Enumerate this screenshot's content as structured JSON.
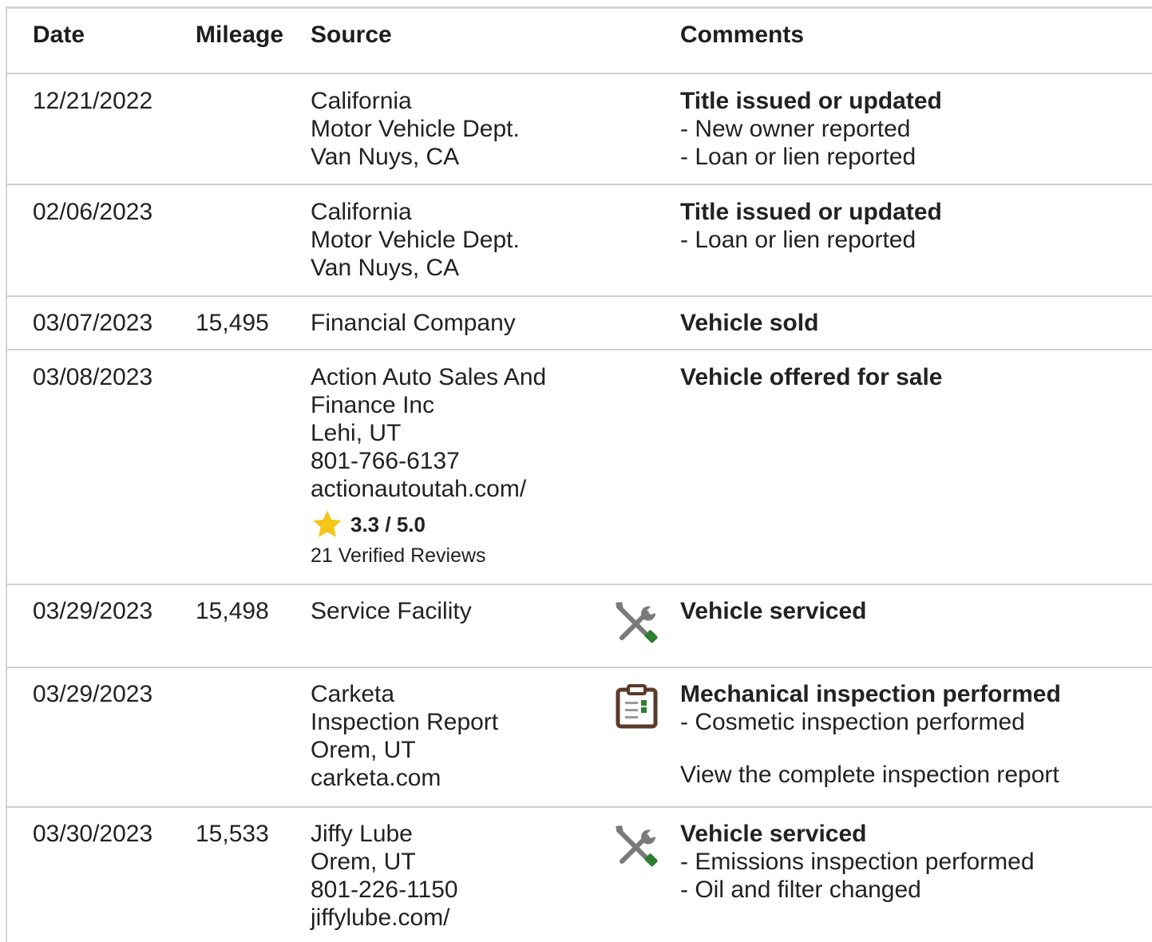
{
  "headers": {
    "date": "Date",
    "mileage": "Mileage",
    "source": "Source",
    "comments": "Comments"
  },
  "rows": [
    {
      "date": "12/21/2022",
      "mileage": "",
      "source": [
        "California",
        "Motor Vehicle Dept.",
        "Van Nuys, CA"
      ],
      "icon": "",
      "comment_title": "Title issued or updated",
      "comment_items": [
        "- New owner reported",
        "- Loan or lien reported"
      ]
    },
    {
      "date": "02/06/2023",
      "mileage": "",
      "source": [
        "California",
        "Motor Vehicle Dept.",
        "Van Nuys, CA"
      ],
      "icon": "",
      "comment_title": "Title issued or updated",
      "comment_items": [
        "- Loan or lien reported"
      ]
    },
    {
      "date": "03/07/2023",
      "mileage": "15,495",
      "source": [
        "Financial Company"
      ],
      "icon": "",
      "comment_title": "Vehicle sold",
      "comment_items": []
    },
    {
      "date": "03/08/2023",
      "mileage": "",
      "source": [
        "Action Auto Sales And",
        "Finance Inc",
        "Lehi, UT",
        "801-766-6137",
        "actionautoutah.com/"
      ],
      "rating": {
        "score": "3.3 / 5.0",
        "reviews": "21 Verified Reviews",
        "star_color": "#f5c518"
      },
      "icon": "",
      "comment_title": "Vehicle offered for sale",
      "comment_items": []
    },
    {
      "date": "03/29/2023",
      "mileage": "15,498",
      "source": [
        "Service Facility"
      ],
      "icon": "wrench-screwdriver-icon",
      "comment_title": "Vehicle serviced",
      "comment_items": []
    },
    {
      "date": "03/29/2023",
      "mileage": "",
      "source": [
        "Carketa",
        "Inspection Report",
        "Orem, UT",
        "carketa.com"
      ],
      "icon": "clipboard-icon",
      "comment_title": "Mechanical inspection performed",
      "comment_items": [
        "- Cosmetic inspection performed"
      ],
      "comment_link": "View the complete inspection report"
    },
    {
      "date": "03/30/2023",
      "mileage": "15,533",
      "source": [
        "Jiffy Lube",
        "Orem, UT",
        "801-226-1150",
        "jiffylube.com/"
      ],
      "icon": "wrench-screwdriver-icon",
      "comment_title": "Vehicle serviced",
      "comment_items": [
        "- Emissions inspection performed",
        "- Oil and filter changed"
      ]
    }
  ],
  "colors": {
    "tool_gray": "#7a7a7a",
    "tool_green": "#2e7d32",
    "clipboard_brown": "#5b3a29",
    "divider": "#cfcfcf"
  }
}
